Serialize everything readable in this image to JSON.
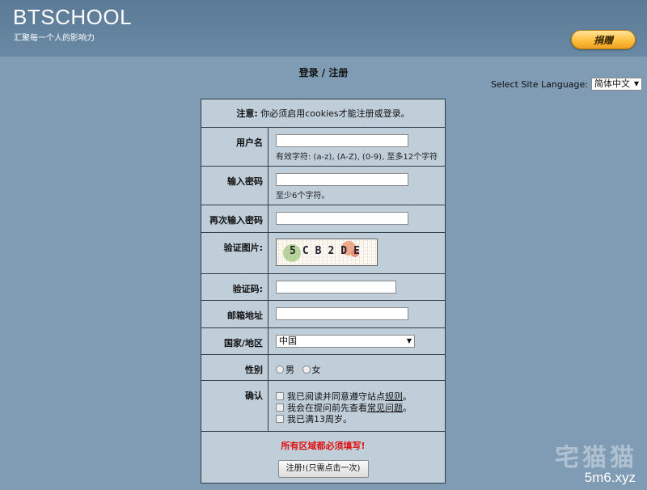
{
  "header": {
    "logo": "BTSCHOOL",
    "slogan": "汇聚每一个人的影响力",
    "donate_label": "捐赠"
  },
  "page": {
    "title": "登录 / 注册",
    "language_label": "Select Site Language:",
    "language_value": "简体中文"
  },
  "form": {
    "notice_label": "注意:",
    "notice_text": "你必须启用cookies才能注册或登录。",
    "username_label": "用户名",
    "username_hint": "有效字符: (a-z), (A-Z), (0-9), 至多12个字符",
    "password_label": "输入密码",
    "password_hint": "至少6个字符。",
    "password2_label": "再次输入密码",
    "captcha_image_label": "验证图片:",
    "captcha_text": "5CB2DE",
    "captcha_code_label": "验证码:",
    "email_label": "邮箱地址",
    "country_label": "国家/地区",
    "country_value": "中国",
    "gender_label": "性别",
    "gender_male": "男",
    "gender_female": "女",
    "confirm_label": "确认",
    "agree_rules_prefix": "我已阅读并同意遵守站点",
    "agree_rules_link": "规则",
    "agree_rules_suffix": "。",
    "agree_faq_prefix": "我会在提问前先查看",
    "agree_faq_link": "常见问题",
    "agree_faq_suffix": "。",
    "agree_age": "我已满13周岁。",
    "required_warning": "所有区域都必须填写!",
    "submit_label": "注册!(只需点击一次)"
  },
  "watermark": {
    "cn": "宅猫猫",
    "url": "5m6.xyz"
  },
  "colors": {
    "page_bg": "#7f9cb4",
    "header_bg": "#5a7a95",
    "form_bg": "#c0ced9",
    "warning": "#e01010",
    "donate": "#ffbf3f"
  }
}
